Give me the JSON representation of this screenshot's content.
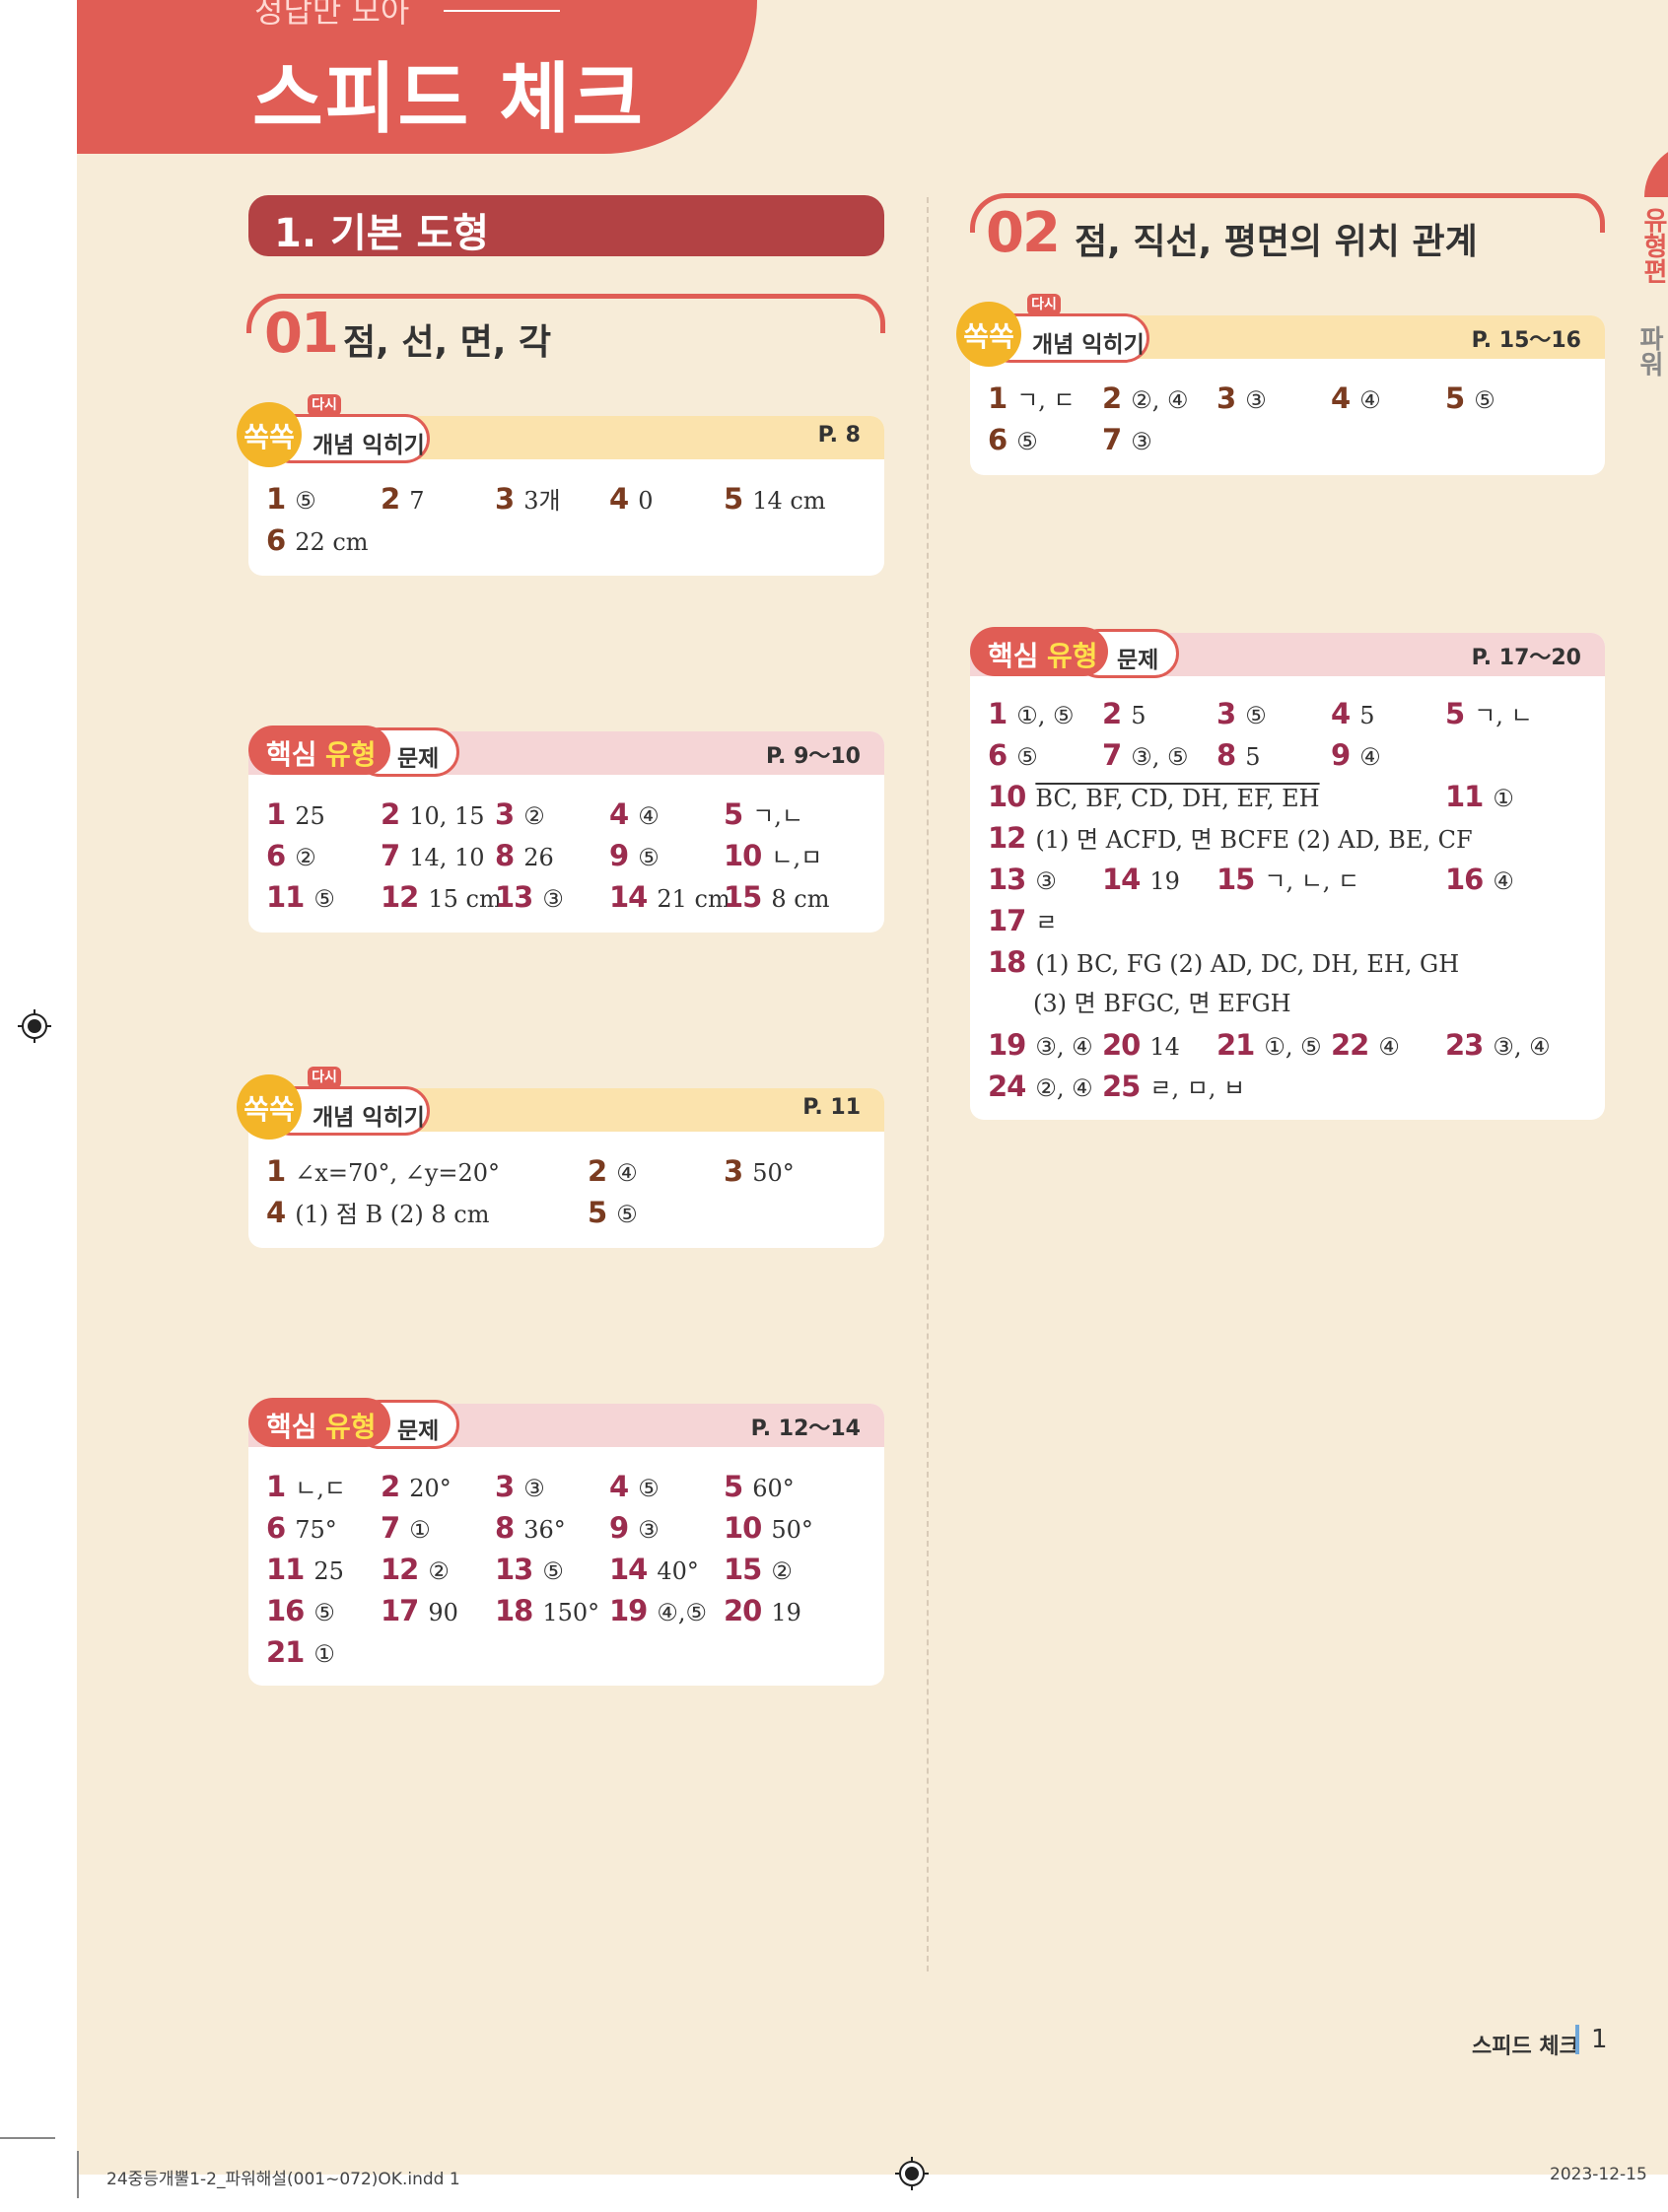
{
  "header": {
    "subtitle": "정답만 모아",
    "title": "스피드 체크"
  },
  "side_tab": {
    "text": "유형편",
    "text2": "파워"
  },
  "chapter": {
    "title": "1. 기본 도형"
  },
  "section1": {
    "num": "01",
    "title": "점, 선, 면, 각"
  },
  "section2": {
    "num": "02",
    "title": "점, 직선, 평면의 위치 관계"
  },
  "labels": {
    "again": "다시",
    "ssok": "쏙쏙",
    "concept": "개념 익히기",
    "core1": "핵심",
    "core2": "유형",
    "problem": "문제"
  },
  "card1": {
    "page": "P. 8",
    "items": [
      {
        "n": "1",
        "a": "⑤"
      },
      {
        "n": "2",
        "a": "7"
      },
      {
        "n": "3",
        "a": "3개"
      },
      {
        "n": "4",
        "a": "0"
      },
      {
        "n": "5",
        "a": "14 cm"
      },
      {
        "n": "6",
        "a": "22 cm"
      }
    ]
  },
  "card2": {
    "page": "P. 9～10",
    "items": [
      {
        "n": "1",
        "a": "25"
      },
      {
        "n": "2",
        "a": "10, 15"
      },
      {
        "n": "3",
        "a": "②"
      },
      {
        "n": "4",
        "a": "④"
      },
      {
        "n": "5",
        "a": "ㄱ,ㄴ"
      },
      {
        "n": "6",
        "a": "②"
      },
      {
        "n": "7",
        "a": "14, 10"
      },
      {
        "n": "8",
        "a": "26"
      },
      {
        "n": "9",
        "a": "⑤"
      },
      {
        "n": "10",
        "a": "ㄴ,ㅁ"
      },
      {
        "n": "11",
        "a": "⑤"
      },
      {
        "n": "12",
        "a": "15 cm"
      },
      {
        "n": "13",
        "a": "③"
      },
      {
        "n": "14",
        "a": "21 cm"
      },
      {
        "n": "15",
        "a": "8 cm"
      }
    ]
  },
  "card3": {
    "page": "P. 11",
    "items": [
      {
        "n": "1",
        "a": "∠x=70°, ∠y=20°"
      },
      {
        "n": "2",
        "a": "④"
      },
      {
        "n": "3",
        "a": "50°"
      },
      {
        "n": "4",
        "a": "(1) 점 B   (2) 8 cm"
      },
      {
        "n": "5",
        "a": "⑤"
      }
    ]
  },
  "card4": {
    "page": "P. 12～14",
    "items": [
      {
        "n": "1",
        "a": "ㄴ,ㄷ"
      },
      {
        "n": "2",
        "a": "20°"
      },
      {
        "n": "3",
        "a": "③"
      },
      {
        "n": "4",
        "a": "⑤"
      },
      {
        "n": "5",
        "a": "60°"
      },
      {
        "n": "6",
        "a": "75°"
      },
      {
        "n": "7",
        "a": "①"
      },
      {
        "n": "8",
        "a": "36°"
      },
      {
        "n": "9",
        "a": "③"
      },
      {
        "n": "10",
        "a": "50°"
      },
      {
        "n": "11",
        "a": "25"
      },
      {
        "n": "12",
        "a": "②"
      },
      {
        "n": "13",
        "a": "⑤"
      },
      {
        "n": "14",
        "a": "40°"
      },
      {
        "n": "15",
        "a": "②"
      },
      {
        "n": "16",
        "a": "⑤"
      },
      {
        "n": "17",
        "a": "90"
      },
      {
        "n": "18",
        "a": "150°"
      },
      {
        "n": "19",
        "a": "④,⑤"
      },
      {
        "n": "20",
        "a": "19"
      },
      {
        "n": "21",
        "a": "①"
      }
    ]
  },
  "card5": {
    "page": "P. 15～16",
    "items": [
      {
        "n": "1",
        "a": "ㄱ, ㄷ"
      },
      {
        "n": "2",
        "a": "②, ④"
      },
      {
        "n": "3",
        "a": "③"
      },
      {
        "n": "4",
        "a": "④"
      },
      {
        "n": "5",
        "a": "⑤"
      },
      {
        "n": "6",
        "a": "⑤"
      },
      {
        "n": "7",
        "a": "③"
      }
    ]
  },
  "card6": {
    "page": "P. 17～20",
    "items": [
      {
        "n": "1",
        "a": "①, ⑤"
      },
      {
        "n": "2",
        "a": "5"
      },
      {
        "n": "3",
        "a": "⑤"
      },
      {
        "n": "4",
        "a": "5"
      },
      {
        "n": "5",
        "a": "ㄱ, ㄴ"
      },
      {
        "n": "6",
        "a": "⑤"
      },
      {
        "n": "7",
        "a": "③, ⑤"
      },
      {
        "n": "8",
        "a": "5"
      },
      {
        "n": "9",
        "a": "④"
      },
      {
        "n": "10",
        "a": "BC, BF, CD, DH, EF, EH"
      },
      {
        "n": "11",
        "a": "①"
      },
      {
        "n": "12",
        "a": "(1) 면 ACFD, 면 BCFE   (2) AD, BE, CF"
      },
      {
        "n": "13",
        "a": "③"
      },
      {
        "n": "14",
        "a": "19"
      },
      {
        "n": "15",
        "a": "ㄱ, ㄴ, ㄷ"
      },
      {
        "n": "16",
        "a": "④"
      },
      {
        "n": "17",
        "a": "ㄹ"
      },
      {
        "n": "18",
        "a": "(1) BC, FG   (2) AD, DC, DH, EH, GH"
      },
      {
        "n": "18b",
        "a": "(3) 면 BFGC, 면 EFGH"
      },
      {
        "n": "19",
        "a": "③, ④"
      },
      {
        "n": "20",
        "a": "14"
      },
      {
        "n": "21",
        "a": "①, ⑤"
      },
      {
        "n": "22",
        "a": "④"
      },
      {
        "n": "23",
        "a": "③, ④"
      },
      {
        "n": "24",
        "a": "②, ④"
      },
      {
        "n": "25",
        "a": "ㄹ, ㅁ, ㅂ"
      }
    ]
  },
  "footer": {
    "title": "스피드 체크",
    "page_number": "1",
    "slug_file": "24중등개뿔1-2_파워해설(001~072)OK.indd   1",
    "slug_date": "2023-12-15"
  }
}
